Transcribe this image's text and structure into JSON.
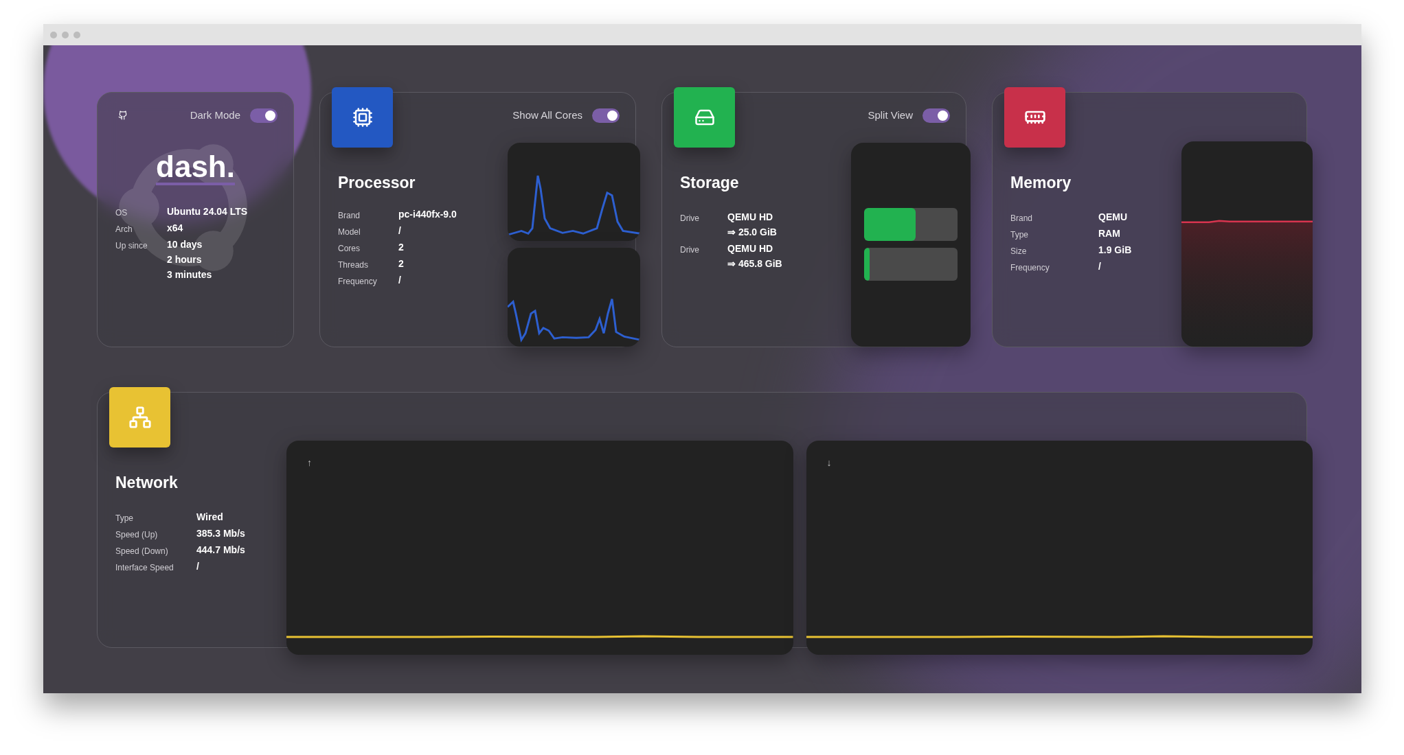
{
  "header": {
    "toggle": {
      "label": "Dark Mode",
      "on": true
    }
  },
  "brand": "dash.",
  "system": {
    "rows": [
      {
        "label": "OS",
        "values": [
          "Ubuntu 24.04 LTS"
        ]
      },
      {
        "label": "Arch",
        "values": [
          "x64"
        ]
      },
      {
        "label": "Up since",
        "values": [
          "10 days",
          "2 hours",
          "3 minutes"
        ]
      }
    ]
  },
  "processor": {
    "title": "Processor",
    "toggle": {
      "label": "Show All Cores",
      "on": true
    },
    "rows": [
      {
        "label": "Brand",
        "values": [
          "pc-i440fx-9.0"
        ]
      },
      {
        "label": "Model",
        "values": [
          "/"
        ]
      },
      {
        "label": "Cores",
        "values": [
          "2"
        ]
      },
      {
        "label": "Threads",
        "values": [
          "2"
        ]
      },
      {
        "label": "Frequency",
        "values": [
          "/"
        ]
      }
    ]
  },
  "storage": {
    "title": "Storage",
    "toggle": {
      "label": "Split View",
      "on": true
    },
    "rows": [
      {
        "label": "Drive",
        "values": [
          "QEMU HD",
          "⇒ 25.0 GiB"
        ],
        "level": 0.55
      },
      {
        "label": "Drive",
        "values": [
          "QEMU HD",
          "⇒ 465.8 GiB"
        ],
        "level": 0.06
      }
    ]
  },
  "memory": {
    "title": "Memory",
    "rows": [
      {
        "label": "Brand",
        "values": [
          "QEMU"
        ]
      },
      {
        "label": "Type",
        "values": [
          "RAM"
        ]
      },
      {
        "label": "Size",
        "values": [
          "1.9 GiB"
        ]
      },
      {
        "label": "Frequency",
        "values": [
          "/"
        ]
      }
    ]
  },
  "network": {
    "title": "Network",
    "rows": [
      {
        "label": "Type",
        "values": [
          "Wired"
        ]
      },
      {
        "label": "Speed (Up)",
        "values": [
          "385.3 Mb/s"
        ]
      },
      {
        "label": "Speed (Down)",
        "values": [
          "444.7 Mb/s"
        ]
      },
      {
        "label": "Interface Speed",
        "values": [
          "/"
        ]
      }
    ],
    "graphs": [
      {
        "arrow": "↑"
      },
      {
        "arrow": "↓"
      }
    ]
  }
}
